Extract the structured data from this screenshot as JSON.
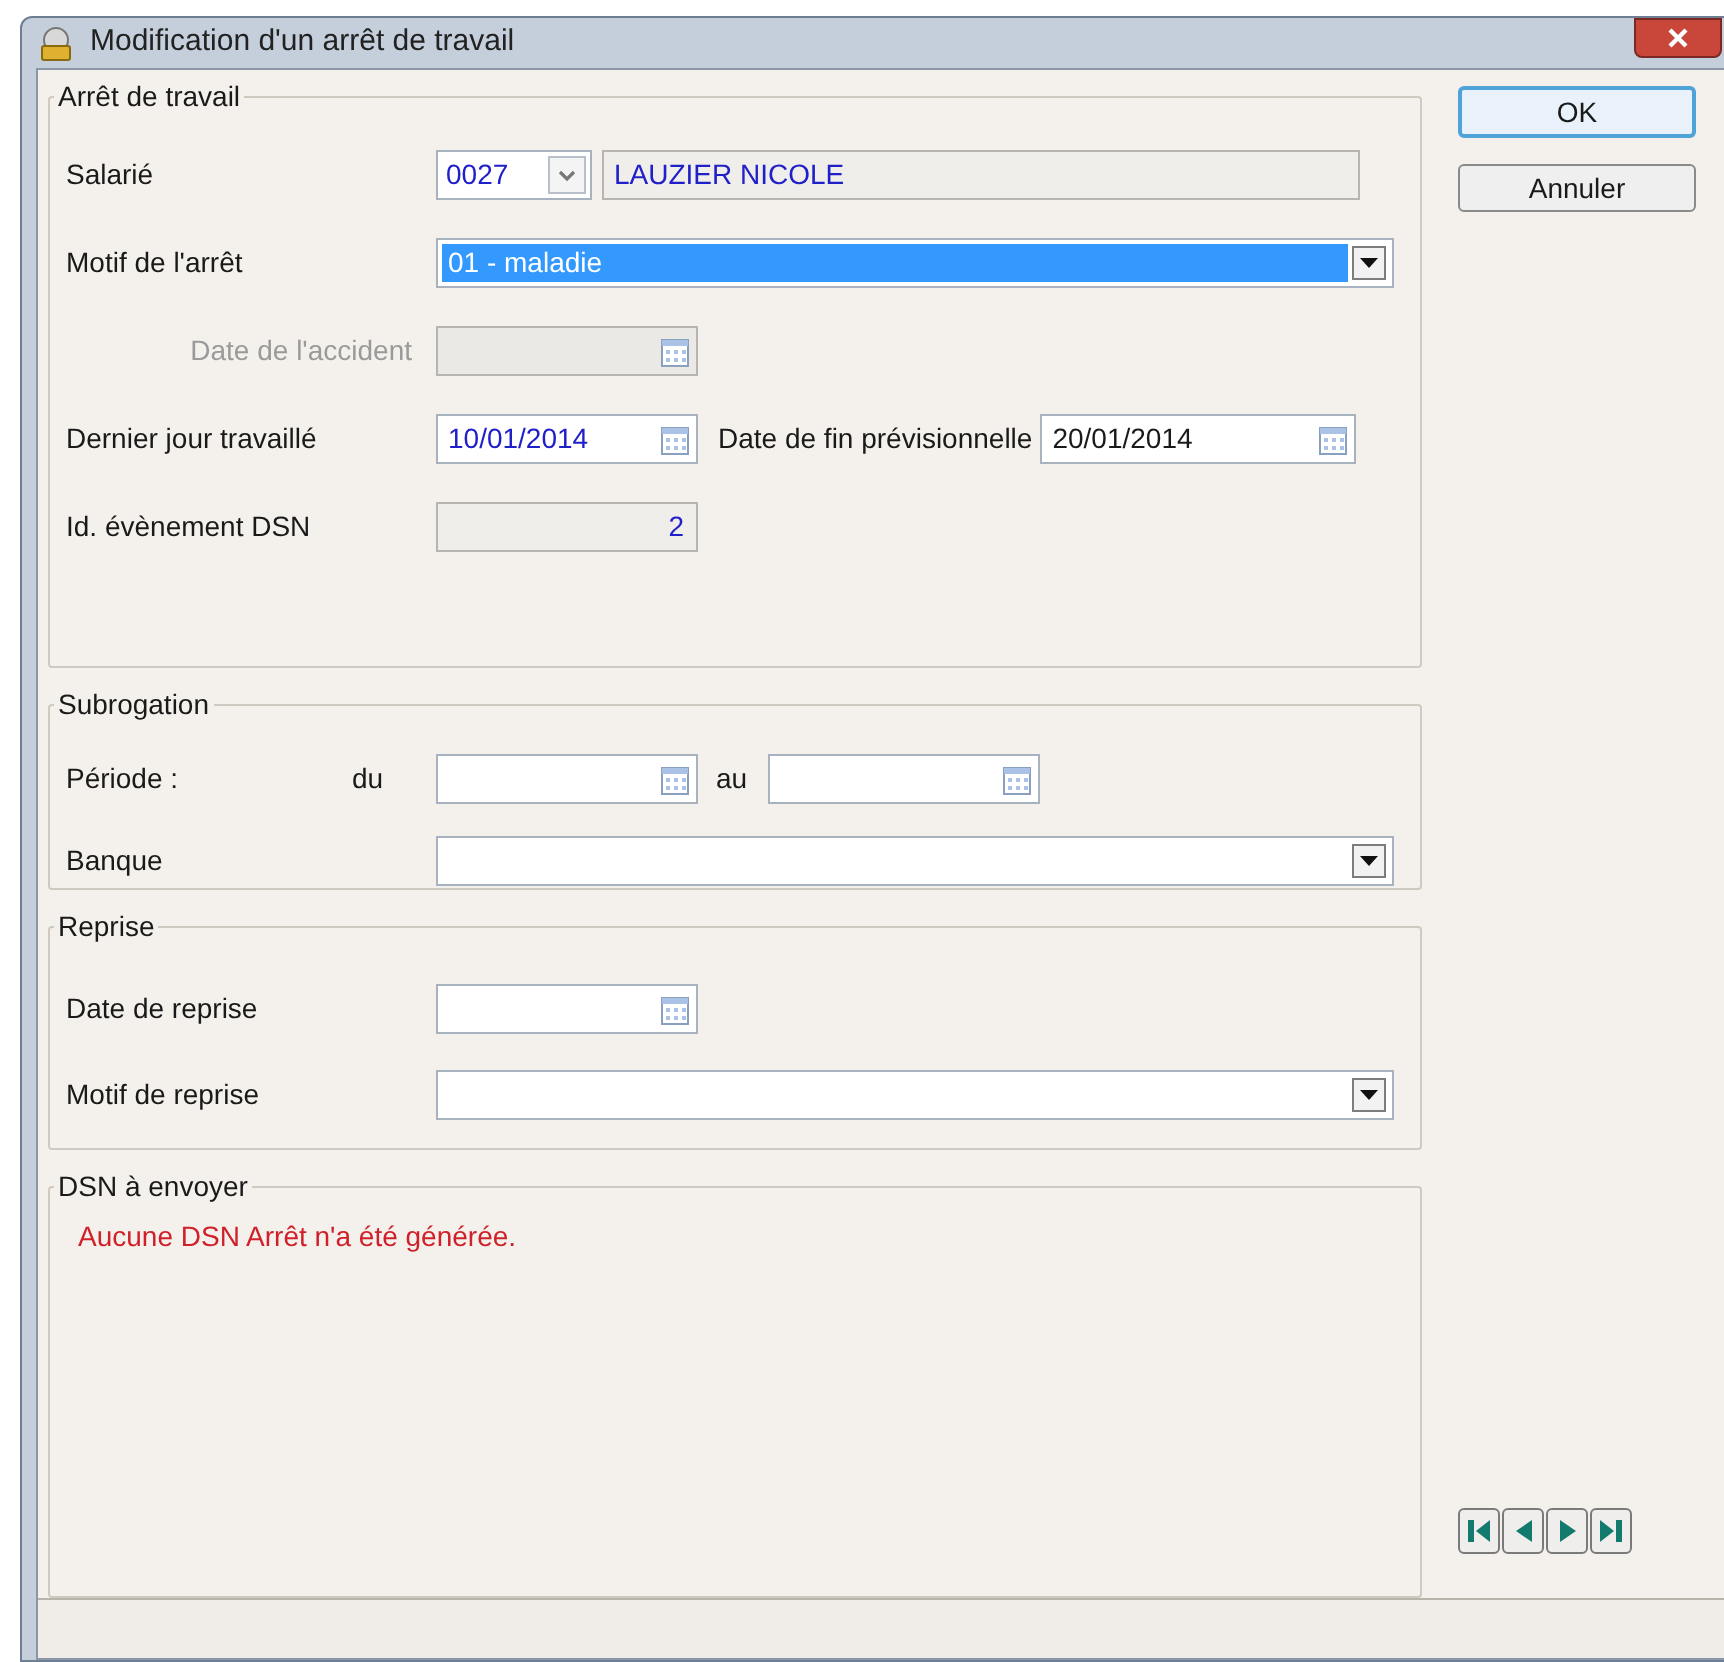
{
  "window": {
    "title": "Modification d'un arrêt de travail"
  },
  "arret": {
    "title": "Arrêt de travail",
    "salarie": {
      "label": "Salarié",
      "code": "0027",
      "name": "LAUZIER NICOLE"
    },
    "motif": {
      "label": "Motif de l'arrêt",
      "value": "01 - maladie",
      "selected": true
    },
    "date_accident": {
      "label": "Date de l'accident",
      "disabled": true
    },
    "dernier_jour": {
      "label": "Dernier jour travaillé",
      "value": "10/01/2014"
    },
    "date_fin": {
      "label": "Date de fin prévisionnelle",
      "value": "20/01/2014"
    },
    "id_dsn": {
      "label": "Id. évènement DSN",
      "value": "2"
    }
  },
  "subrogation": {
    "title": "Subrogation",
    "periode_label": "Période :",
    "du_label": "du",
    "au_label": "au",
    "banque_label": "Banque"
  },
  "reprise": {
    "title": "Reprise",
    "date_label": "Date de reprise",
    "motif_label": "Motif de reprise"
  },
  "dsn": {
    "title": "DSN à envoyer",
    "message": "Aucune DSN Arrêt n'a été générée."
  },
  "buttons": [
    {
      "label": "OK",
      "default": true
    },
    {
      "label": "Annuler",
      "default": false
    }
  ]
}
